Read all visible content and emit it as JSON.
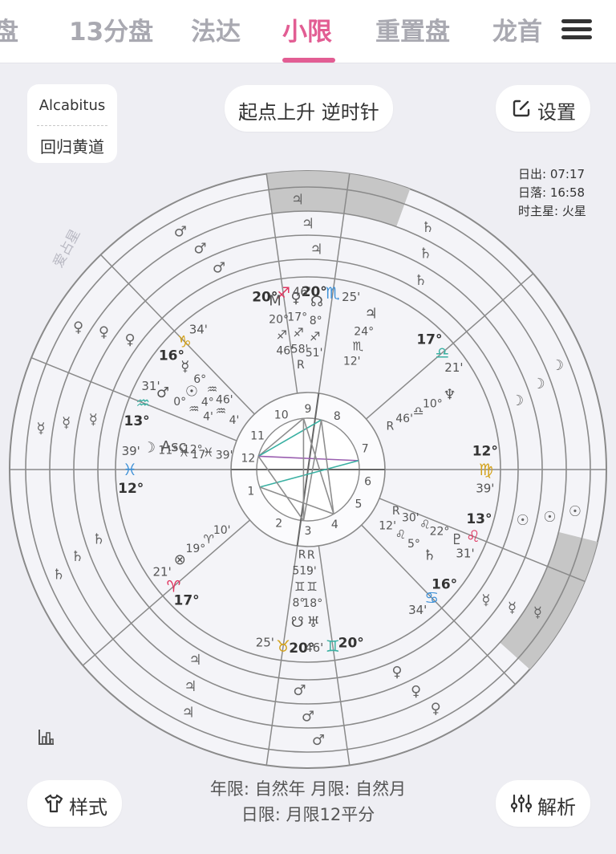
{
  "tabs": [
    {
      "label": "盘",
      "active": false
    },
    {
      "label": "13分盘",
      "active": false
    },
    {
      "label": "法达",
      "active": false
    },
    {
      "label": "小限",
      "active": true
    },
    {
      "label": "重置盘",
      "active": false
    },
    {
      "label": "龙首",
      "active": false
    }
  ],
  "house_system": {
    "name": "Alcabitus",
    "zodiac": "回归黄道"
  },
  "orientation_label": "起点上升 逆时针",
  "settings_label": "设置",
  "sun_info": {
    "sunrise": "日出: 07:17",
    "sunset": "日落: 16:58",
    "hour_ruler": "时主星: 火星"
  },
  "watermark": "爱占星",
  "footer": {
    "line1": "年限: 自然年 月限: 自然月",
    "line2": "日限: 月限12平分",
    "style_label": "样式",
    "analysis_label": "解析"
  },
  "colors": {
    "accent": "#e25d93",
    "fire": "#e0355f",
    "earth": "#d3a21c",
    "air": "#3ab0a2",
    "water": "#3b8fd6",
    "wheel": "#8a8a8a",
    "highlight": "#c6c6c6"
  },
  "wheel": {
    "house_numbers": [
      "1",
      "2",
      "3",
      "4",
      "5",
      "6",
      "7",
      "8",
      "9",
      "10",
      "11",
      "12"
    ],
    "cusps": [
      {
        "deg": "12°",
        "sign": "♓",
        "min": "39'"
      },
      {
        "deg": "17°",
        "sign": "♈",
        "min": "21'"
      },
      {
        "deg": "20°",
        "sign": "♉",
        "min": "25'"
      },
      {
        "deg": "20°",
        "sign": "♊",
        "min": "46'"
      },
      {
        "deg": "16°",
        "sign": "♋",
        "min": "34'"
      },
      {
        "deg": "13°",
        "sign": "♌",
        "min": "31'"
      },
      {
        "deg": "12°",
        "sign": "♍",
        "min": "39'"
      },
      {
        "deg": "17°",
        "sign": "♎",
        "min": "21'"
      },
      {
        "deg": "20°",
        "sign": "♏",
        "min": "25'"
      },
      {
        "deg": "20°",
        "sign": "♐",
        "min": "46'"
      },
      {
        "deg": "16°",
        "sign": "♑",
        "min": "34'"
      },
      {
        "deg": "13°",
        "sign": "♒",
        "min": "31'"
      }
    ],
    "ring_planets": [
      "♄",
      "♃",
      "♂",
      "♀",
      "☿",
      "☉",
      "☽"
    ],
    "planets": [
      {
        "name": "Moon",
        "glyph": "☽",
        "deg": "11°",
        "sign": "♓",
        "min": "17'"
      },
      {
        "name": "Ascendant",
        "glyph": "Asc",
        "deg": "12°",
        "sign": "♓",
        "min": "39'"
      },
      {
        "name": "Part of Fortune",
        "glyph": "⊗",
        "deg": "19°",
        "sign": "♈",
        "min": "10'"
      },
      {
        "name": "Mars",
        "glyph": "♂",
        "deg": "0°",
        "sign": "♒",
        "min": "4'"
      },
      {
        "name": "Sun",
        "glyph": "☉",
        "deg": "4°",
        "sign": "♒",
        "min": "4'"
      },
      {
        "name": "Mercury",
        "glyph": "☿",
        "deg": "6°",
        "sign": "♒",
        "min": "46'"
      },
      {
        "name": "Midheaven",
        "glyph": "M",
        "deg": "20°",
        "sign": "♐",
        "min": "46'"
      },
      {
        "name": "Venus",
        "glyph": "♀",
        "deg": "17°",
        "sign": "♐",
        "min": "58'",
        "retro": "R"
      },
      {
        "name": "North Node",
        "glyph": "☊",
        "deg": "8°",
        "sign": "♐",
        "min": "51'"
      },
      {
        "name": "Jupiter",
        "glyph": "♃",
        "deg": "24°",
        "sign": "♏",
        "min": "12'"
      },
      {
        "name": "Neptune",
        "glyph": "♆",
        "deg": "10°",
        "sign": "♎",
        "min": "46'",
        "retro": "R"
      },
      {
        "name": "Pluto",
        "glyph": "♇",
        "deg": "22°",
        "sign": "♌",
        "min": "30'",
        "retro": "R"
      },
      {
        "name": "Saturn",
        "glyph": "♄",
        "deg": "5°",
        "sign": "♌",
        "min": "12'"
      },
      {
        "name": "Uranus",
        "glyph": "♅",
        "deg": "18°",
        "sign": "♊",
        "min": "9'",
        "retro": "R"
      },
      {
        "name": "South Node",
        "glyph": "☋",
        "deg": "8°",
        "sign": "♊",
        "min": "51'",
        "retro": "R"
      }
    ]
  }
}
